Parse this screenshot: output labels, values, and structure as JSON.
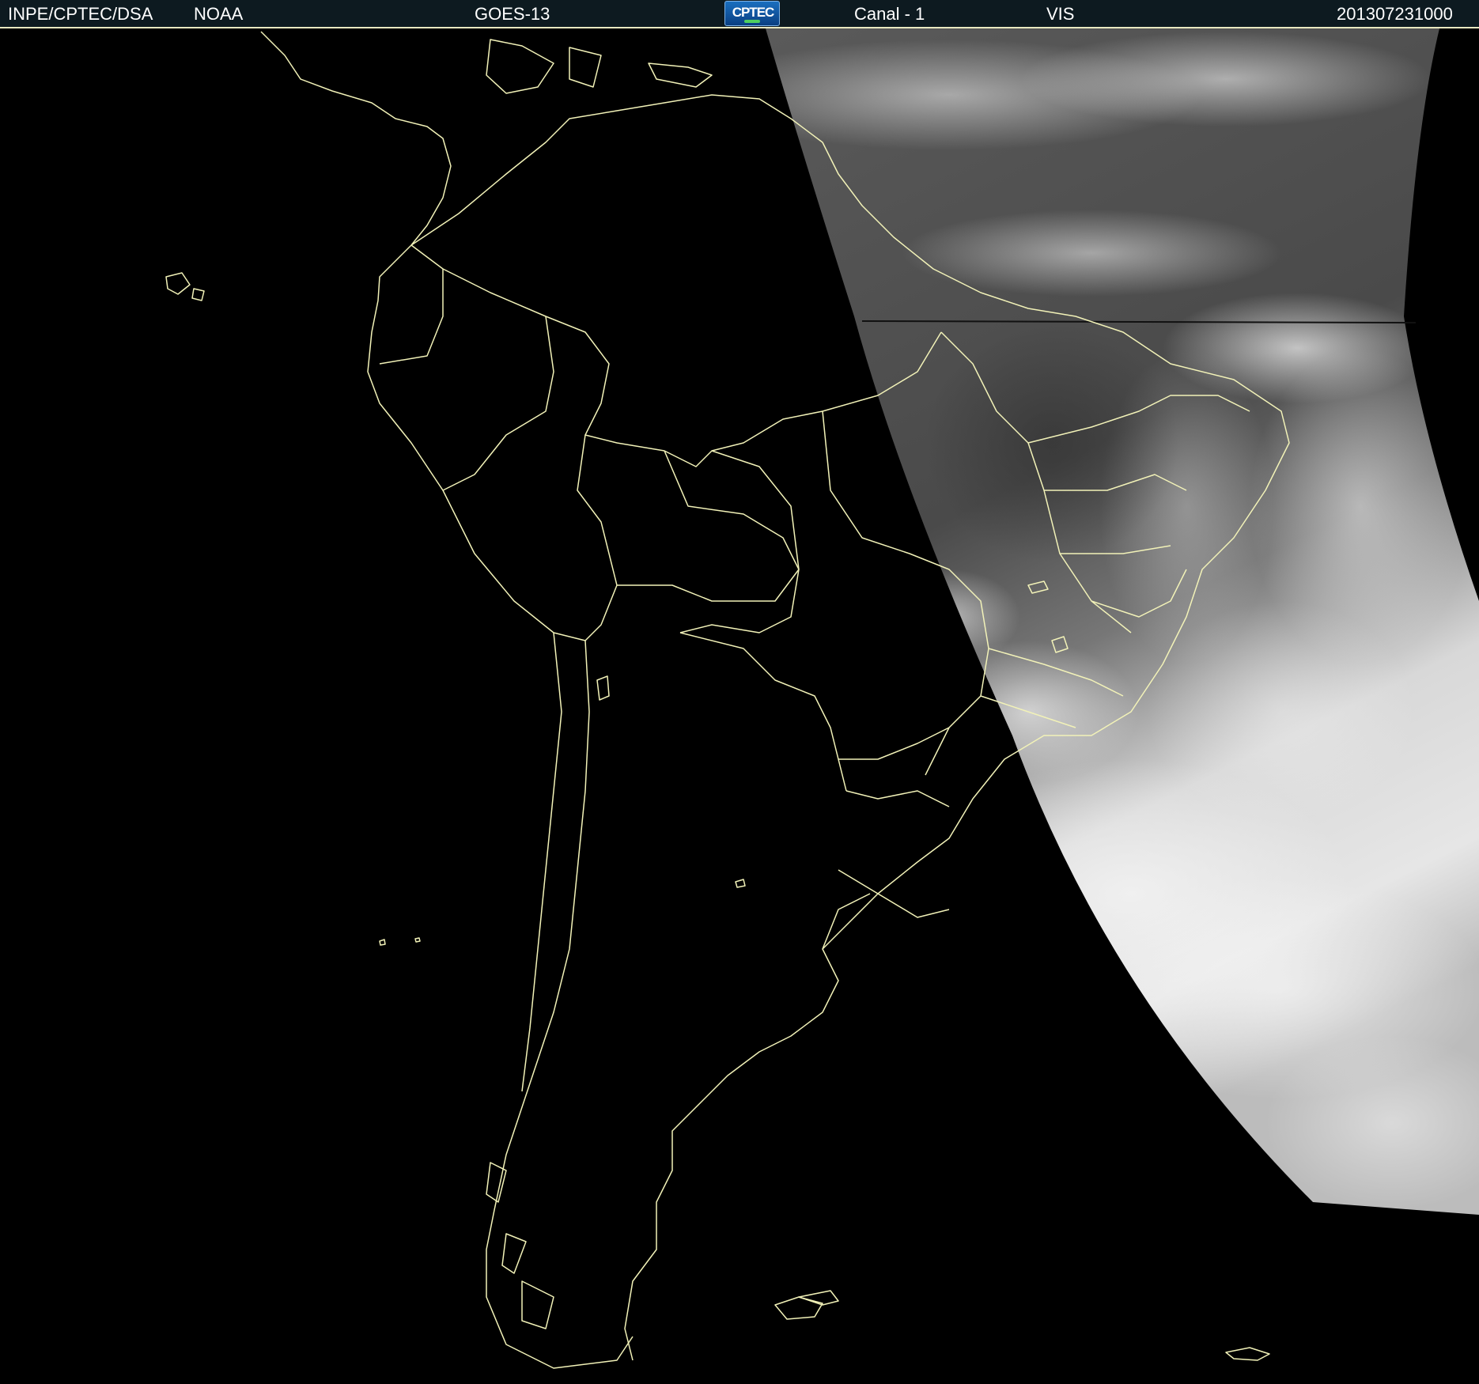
{
  "header": {
    "agency": "INPE/CPTEC/DSA",
    "source": "NOAA",
    "satellite": "GOES-13",
    "logo_text": "CPTEC",
    "channel": "Canal - 1",
    "band": "VIS",
    "timestamp": "201307231000"
  },
  "colors": {
    "header_bg": "#0d1a20",
    "header_border": "#e8e8c0",
    "boundary_lines": "#f2f2b8",
    "night_side": "#000000",
    "cloud_tops": "#f0f0f0",
    "ocean_day": "#4a4a4a"
  },
  "icons": {
    "logo": "cptec-logo-icon"
  }
}
